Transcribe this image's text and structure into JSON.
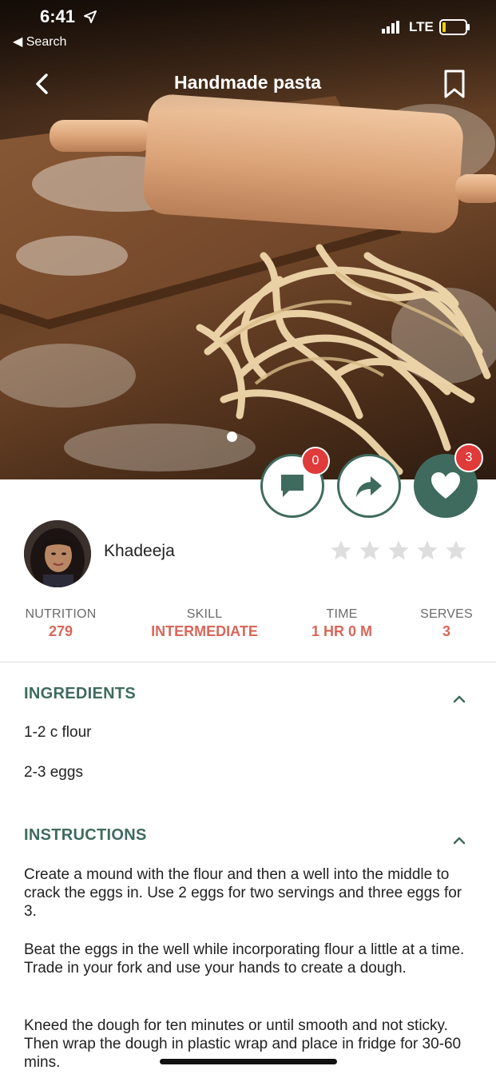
{
  "status_bar": {
    "time": "6:41",
    "back_label": "◀ Search",
    "network": "LTE",
    "icons": [
      "location-arrow-icon",
      "signal-icon",
      "battery-icon"
    ]
  },
  "nav": {
    "title": "Handmade pasta",
    "icons": [
      "back-chevron-icon",
      "bookmark-icon"
    ]
  },
  "hero": {
    "image": "photo of fresh pasta ribbons and rolling pin on floured wooden board",
    "carousel_pages": 1,
    "carousel_active": 1
  },
  "actions": {
    "comments": {
      "icon": "comment-icon",
      "count": "0"
    },
    "share": {
      "icon": "share-arrow-icon"
    },
    "likes": {
      "icon": "heart-icon",
      "count": "3"
    }
  },
  "author": {
    "name": "Khadeeja",
    "rating": 0,
    "rating_max": 5
  },
  "stats": [
    {
      "label": "NUTRITION",
      "value": "279"
    },
    {
      "label": "SKILL",
      "value": "INTERMEDIATE"
    },
    {
      "label": "TIME",
      "value": "1 HR 0 M"
    },
    {
      "label": "SERVES",
      "value": "3"
    }
  ],
  "ingredients": {
    "title": "INGREDIENTS",
    "items": [
      "1-2 c flour",
      "2-3 eggs"
    ]
  },
  "instructions": {
    "title": "INSTRUCTIONS",
    "steps": [
      "Create a mound with the flour and then a well into the middle to crack the eggs in. Use 2 eggs for two servings and three eggs for 3.",
      "Beat the eggs in the well while incorporating flour a little at a time. Trade in your fork and use your hands to create a dough.",
      "Kneed the dough for ten minutes or until smooth and not sticky. Then wrap the dough in plastic wrap and place in fridge for 30-60 mins."
    ]
  },
  "colors": {
    "accent": "#3f6b5e",
    "stat_value": "#d9665a",
    "badge": "#e03a3a",
    "star_empty": "#dedede"
  }
}
